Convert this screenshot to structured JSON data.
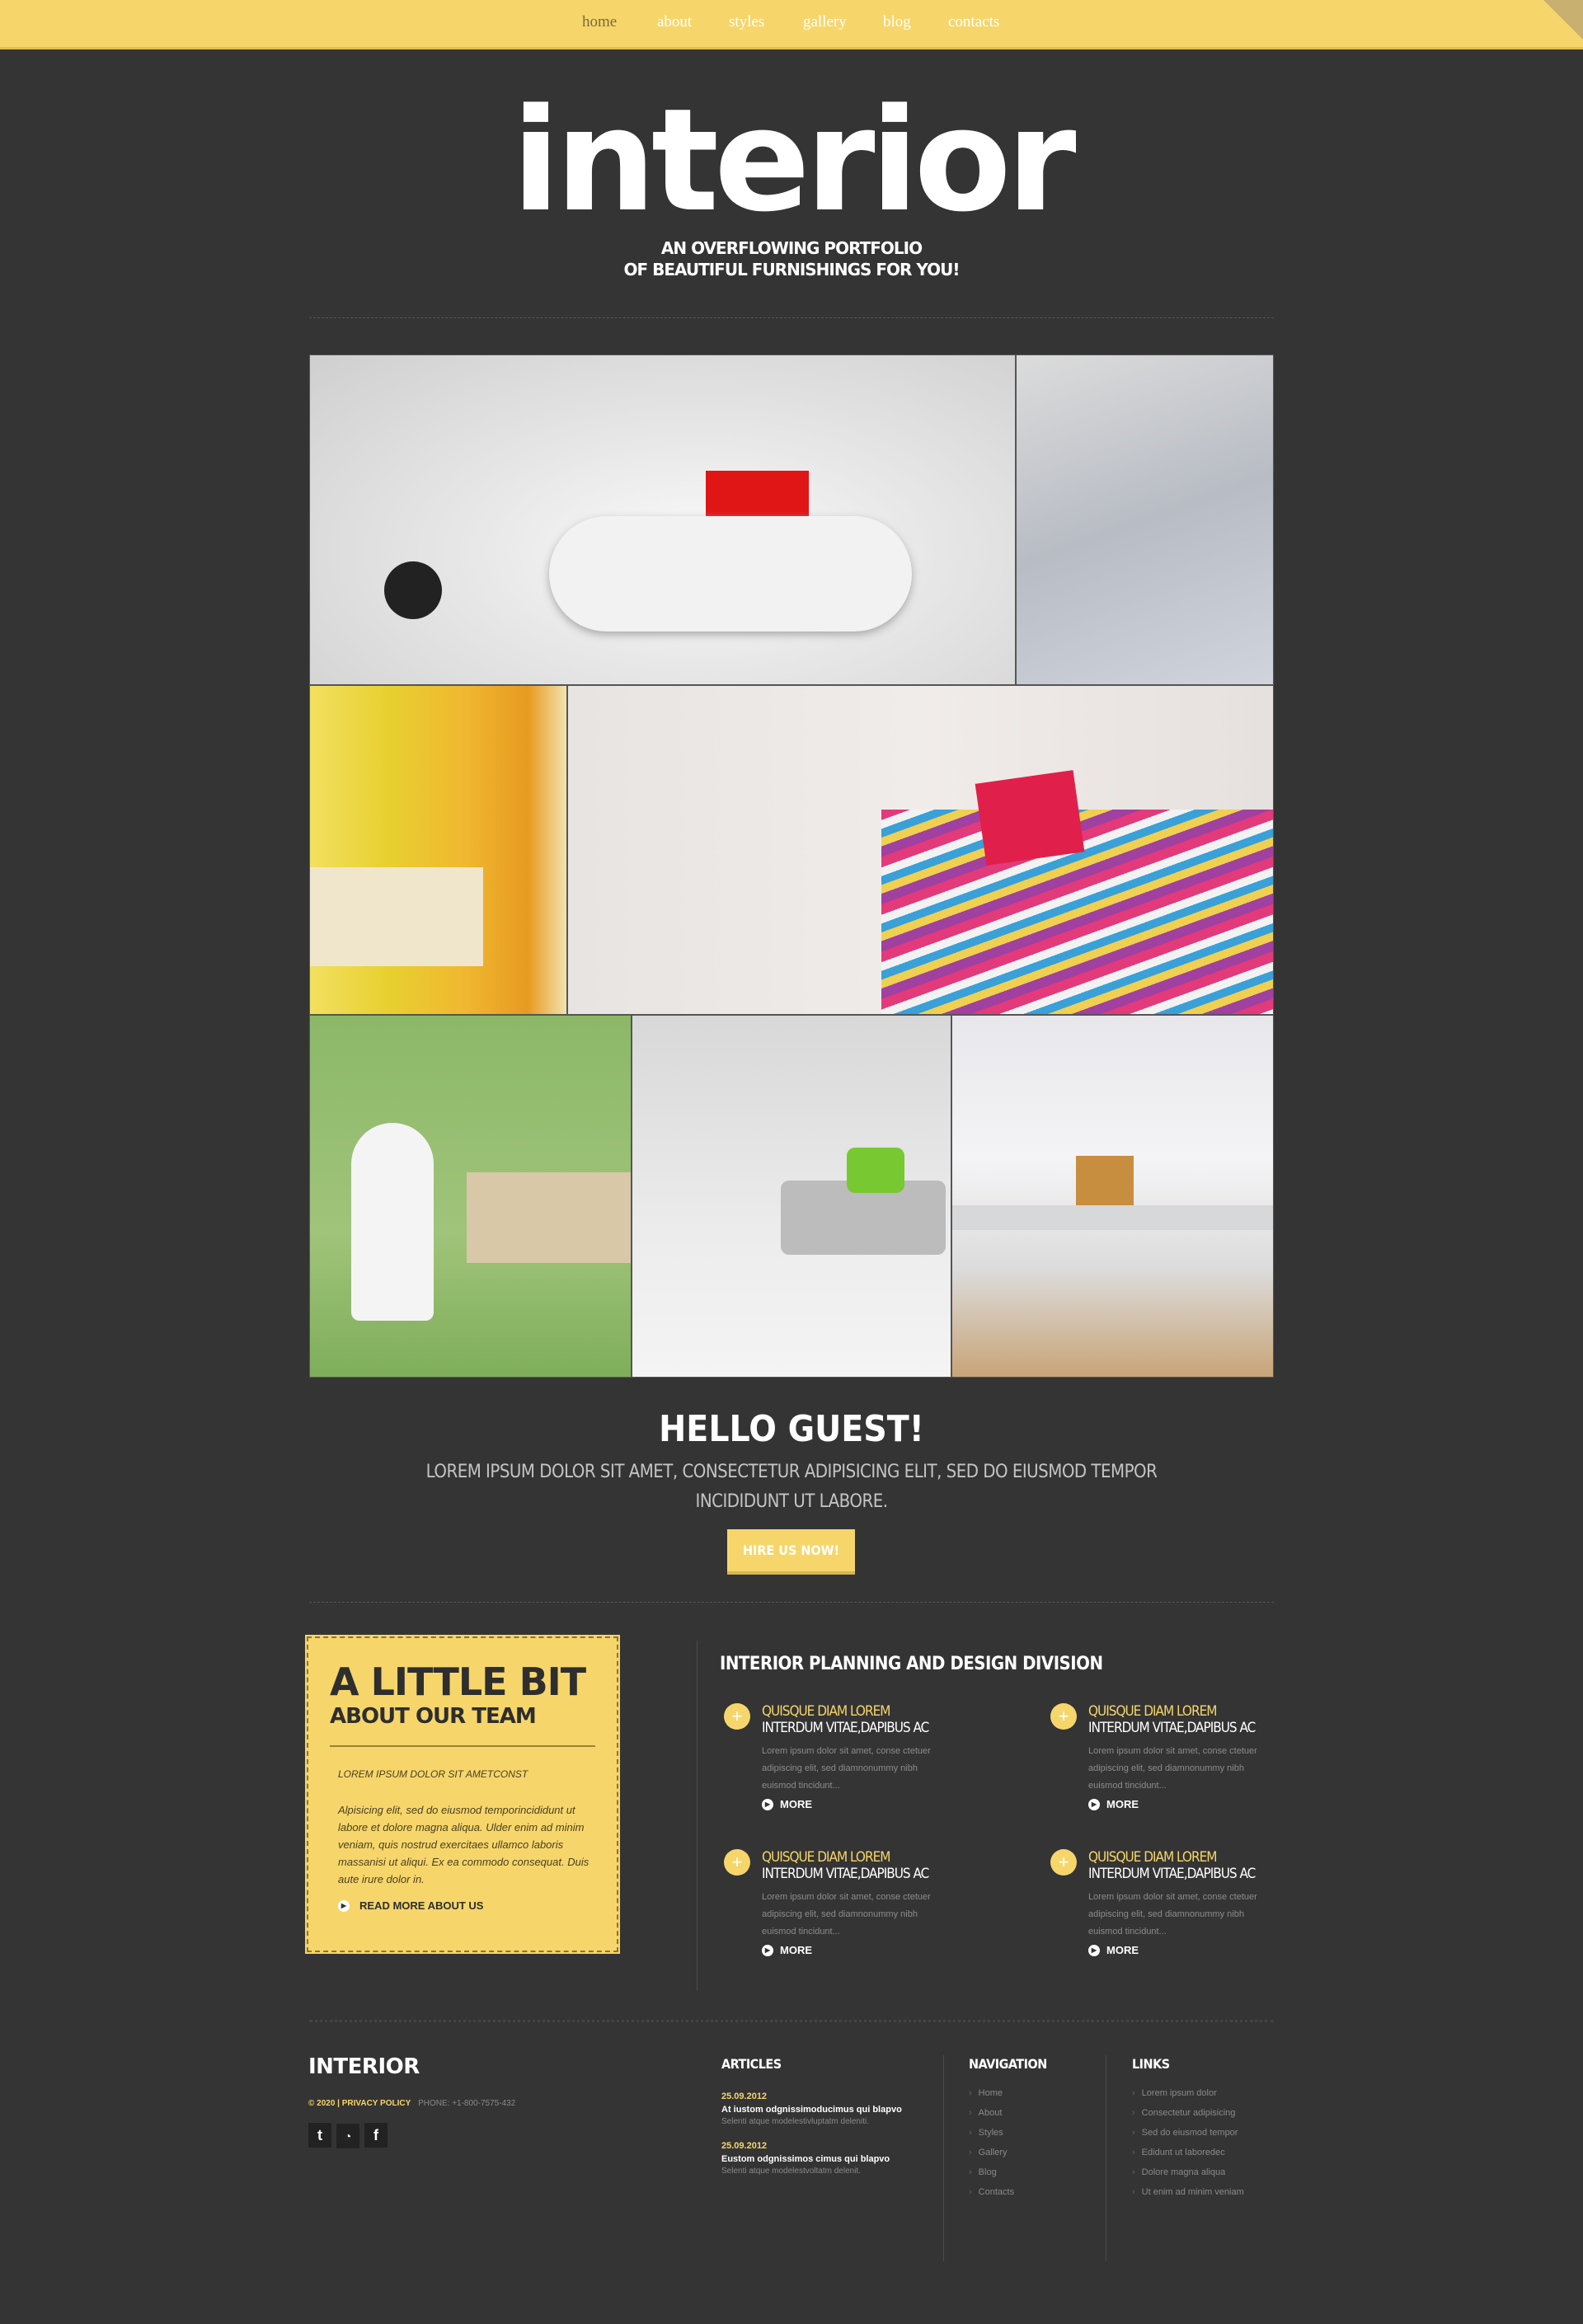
{
  "nav": {
    "items": [
      "home",
      "about",
      "styles",
      "gallery",
      "blog",
      "contacts"
    ],
    "active": 0
  },
  "header": {
    "logo": "interior",
    "tagline_1": "AN OVERFLOWING PORTFOLIO",
    "tagline_2": "OF BEAUTIFUL FURNISHINGS FOR YOU!"
  },
  "gallery": {
    "images": [
      "living-room-white-sofa",
      "bedroom-pillows",
      "yellow-striped-wall",
      "striped-bedding",
      "green-chair",
      "grey-sofa",
      "winter-desk"
    ]
  },
  "hello": {
    "title": "HELLO GUEST!",
    "line_1": "LOREM IPSUM DOLOR SIT AMET, CONSECTETUR ADIPISICING ELIT, SED DO EIUSMOD TEMPOR",
    "line_2": "INCIDIDUNT UT LABORE.",
    "button": "HIRE US NOW!"
  },
  "team": {
    "title": "A LITTLE BIT",
    "subtitle": "ABOUT OUR TEAM",
    "lead": "LOREM IPSUM DOLOR SIT AMETCONST",
    "body": "Alpisicing elit, sed do eiusmod temporincididunt ut labore et dolore magna aliqua. Ulder enim ad minim veniam, quis nostrud exercitaes ullamco laboris massanisi ut aliqui. Ex ea commodo consequat. Duis aute irure dolor in.",
    "link": "READ MORE ABOUT US"
  },
  "services": {
    "title": "INTERIOR PLANNING AND DESIGN DIVISION",
    "items": [
      {
        "t1": "QUISQUE DIAM LOREM",
        "t2": "INTERDUM VITAE,DAPIBUS AC",
        "d": "Lorem ipsum dolor sit amet, conse ctetuer adipiscing elit, sed diamnonummy nibh euismod tincidunt...",
        "more": "MORE"
      },
      {
        "t1": "QUISQUE DIAM LOREM",
        "t2": "INTERDUM VITAE,DAPIBUS AC",
        "d": "Lorem ipsum dolor sit amet, conse ctetuer adipiscing elit, sed diamnonummy nibh euismod tincidunt...",
        "more": "MORE"
      },
      {
        "t1": "QUISQUE DIAM LOREM",
        "t2": "INTERDUM VITAE,DAPIBUS AC",
        "d": "Lorem ipsum dolor sit amet, conse ctetuer adipiscing elit, sed diamnonummy nibh euismod tincidunt...",
        "more": "MORE"
      },
      {
        "t1": "QUISQUE DIAM LOREM",
        "t2": "INTERDUM VITAE,DAPIBUS AC",
        "d": "Lorem ipsum dolor sit amet, conse ctetuer adipiscing elit, sed diamnonummy nibh euismod tincidunt...",
        "more": "MORE"
      }
    ]
  },
  "footer": {
    "brand": "INTERIOR",
    "copyright": "© 2020 | PRIVACY POLICY",
    "phone": "PHONE: +1-800-7575-432",
    "social": [
      "twitter-icon",
      "rss-icon",
      "facebook-icon"
    ],
    "articles": {
      "title": "ARTICLES",
      "items": [
        {
          "date": "25.09.2012",
          "title": "At iustom odgnissimoducimus qui blapvo",
          "text": "Selenti atque modelestivluptatm deleniti."
        },
        {
          "date": "25.09.2012",
          "title": "Eustom odgnissimos cimus qui blapvo",
          "text": "Selenti atque modelestvoltatm delenit."
        }
      ]
    },
    "navigation": {
      "title": "NAVIGATION",
      "items": [
        "Home",
        "About",
        "Styles",
        "Gallery",
        "Blog",
        "Contacts"
      ]
    },
    "links": {
      "title": "LINKS",
      "items": [
        "Lorem ipsum dolor",
        "Consectetur adipisicing",
        "Sed do eiusmod tempor",
        "Edidunt ut laboredec",
        "Dolore magna aliqua",
        "Ut enim ad minim veniam"
      ]
    }
  },
  "colors": {
    "accent": "#f6d66b",
    "bg": "#343434"
  }
}
